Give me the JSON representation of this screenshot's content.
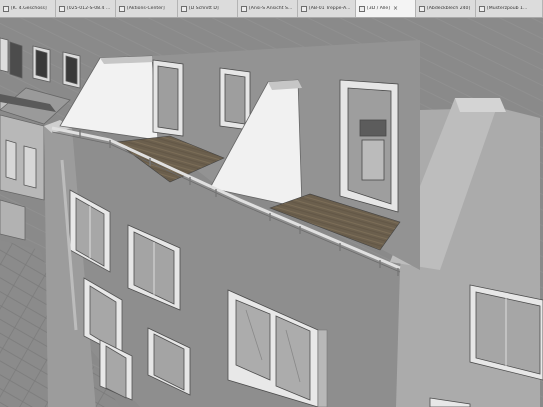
{
  "window": {
    "tabs": [
      {
        "label": "[K. 4.Geschoss]",
        "active": false,
        "icon": "floor-plan-icon"
      },
      {
        "label": "[025-012-S-08.4 ...",
        "active": false,
        "icon": "section-icon"
      },
      {
        "label": "[Aktions-Center]",
        "active": false,
        "icon": "action-center-icon"
      },
      {
        "label": "[D Schnitt D]",
        "active": false,
        "icon": "section-icon"
      },
      {
        "label": "[Ansi-S Ansicht S...",
        "active": false,
        "icon": "elevation-icon"
      },
      {
        "label": "[AB-01 Treppe-A...",
        "active": false,
        "icon": "detail-icon"
      },
      {
        "label": "[3D / Alle]",
        "active": true,
        "icon": "3d-view-icon",
        "close": "×"
      },
      {
        "label": "[Abdeckblech 240]",
        "active": false,
        "icon": "detail-icon"
      },
      {
        "label": "[Musterzpoub 1...",
        "active": false,
        "icon": "detail-icon"
      }
    ]
  },
  "viewport": {
    "view": "3D axonometric model view",
    "colors": {
      "background": "#8c8c8c",
      "wall_front": "#8e8e8e",
      "wall_light": "#f2f2f2",
      "wall_right": "#adadad",
      "deck": "#6a5e4c",
      "railing": "#d6d6d6",
      "window_frame": "#ececec",
      "glass": "#b4b4b4"
    }
  }
}
